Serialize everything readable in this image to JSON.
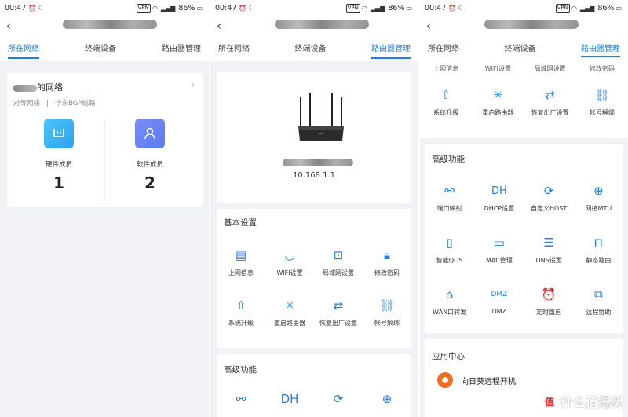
{
  "status_bar": {
    "time": "00:47",
    "vpn": "VPN",
    "battery": "86%"
  },
  "tabs": [
    "所在网络",
    "终端设备",
    "路由器管理"
  ],
  "network": {
    "name": "的网络",
    "line_type": "对等网络",
    "separator": "|",
    "line_name": "华东BGP线路",
    "members": [
      {
        "label": "硬件成员",
        "count": "1"
      },
      {
        "label": "软件成员",
        "count": "2"
      }
    ]
  },
  "router": {
    "ip": "10.168.1.1"
  },
  "basic_settings": {
    "title": "基本设置",
    "items": [
      {
        "label": "上网信息",
        "icon": "document-icon"
      },
      {
        "label": "WIFI设置",
        "icon": "wifi-icon"
      },
      {
        "label": "局域网设置",
        "icon": "lan-icon"
      },
      {
        "label": "修改密码",
        "icon": "lock-icon"
      },
      {
        "label": "系统升级",
        "icon": "upgrade-arrow-icon"
      },
      {
        "label": "重启路由器",
        "icon": "loading-spinner-icon"
      },
      {
        "label": "恢复出厂设置",
        "icon": "swap-arrows-icon"
      },
      {
        "label": "帐号解绑",
        "icon": "broken-link-icon"
      }
    ]
  },
  "advanced": {
    "title": "高级功能",
    "items": [
      {
        "label": "端口映射",
        "icon": "share-nodes-icon",
        "glyph": "⚯"
      },
      {
        "label": "DHCP设置",
        "icon": "dhcp-icon",
        "glyph": "DH"
      },
      {
        "label": "自定义HOST",
        "icon": "refresh-circle-icon",
        "glyph": "⟳"
      },
      {
        "label": "网络MTU",
        "icon": "mtu-icon",
        "glyph": "⊕"
      },
      {
        "label": "智能QOS",
        "icon": "qos-icon",
        "glyph": "▯"
      },
      {
        "label": "MAC管理",
        "icon": "monitor-icon",
        "glyph": "▭"
      },
      {
        "label": "DNS设置",
        "icon": "server-icon",
        "glyph": "☰"
      },
      {
        "label": "静态路由",
        "icon": "static-route-icon",
        "glyph": "⊓"
      },
      {
        "label": "WAN口转发",
        "icon": "wan-forward-icon",
        "glyph": "⌂"
      },
      {
        "label": "DMZ",
        "icon": "dmz-icon",
        "glyph": "DMZ"
      },
      {
        "label": "定时重启",
        "icon": "alarm-clock-icon",
        "glyph": "⏰"
      },
      {
        "label": "远程协助",
        "icon": "remote-monitor-icon",
        "glyph": "⧉"
      }
    ]
  },
  "app_center": {
    "title": "应用中心",
    "app": "向日葵远程开机"
  },
  "watermark": {
    "badge": "值",
    "text": "什么值得买"
  },
  "colors": {
    "accent": "#1f7fe8",
    "background": "#f1f2f6"
  }
}
